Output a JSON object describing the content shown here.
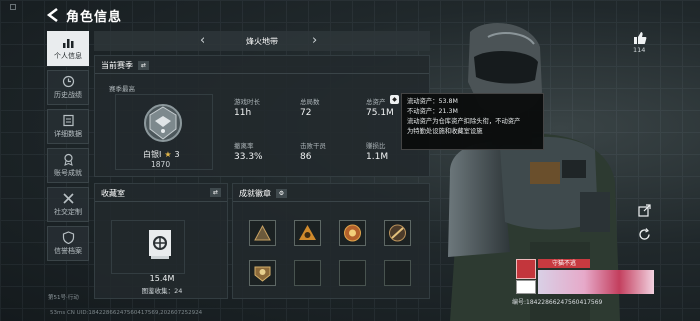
{
  "header": {
    "title": "角色信息"
  },
  "sidebar": {
    "items": [
      {
        "label": "个人信息",
        "icon": "bar-chart-icon",
        "active": true
      },
      {
        "label": "历史战绩",
        "icon": "history-icon"
      },
      {
        "label": "详细数据",
        "icon": "document-icon"
      },
      {
        "label": "账号成就",
        "icon": "achievement-icon"
      },
      {
        "label": "社交定制",
        "icon": "tools-icon"
      },
      {
        "label": "信誉档案",
        "icon": "shield-icon"
      }
    ],
    "footer": "第51号·行动"
  },
  "season": {
    "name": "烽火地带"
  },
  "current_season": {
    "title": "当前赛季",
    "season_high_label": "赛季最高",
    "rank_name": "白银I",
    "rank_stars": "3",
    "rank_score": "1870",
    "stats": [
      {
        "label": "游戏时长",
        "value": "11h"
      },
      {
        "label": "总局数",
        "value": "72"
      },
      {
        "label": "总资产",
        "value": "75.1M"
      },
      {
        "label": "撤离率",
        "value": "33.3%"
      },
      {
        "label": "击败干员",
        "value": "86"
      },
      {
        "label": "赚损比",
        "value": "1.1M"
      }
    ]
  },
  "tooltip": {
    "line1": "流动资产：53.8M",
    "line2": "不动资产：21.3M",
    "line3": "流动资产为仓库资产扣除头衔，不动资产",
    "line4": "为特勤处设施和收藏室设施"
  },
  "collection": {
    "title": "收藏室",
    "value": "15.4M",
    "count_label": "图鉴收集：24"
  },
  "achievements": {
    "title": "成就徽章"
  },
  "right_panel": {
    "like_count": "114"
  },
  "profile": {
    "name": "守猫不逃",
    "uid": "编号:18422866247560417569"
  },
  "bottom": {
    "text": "53ms   CN UID:18422866247560417569,202607252924"
  },
  "colors": {
    "accent": "#d8303a",
    "panel": "#222a2d",
    "active": "#e9ecee"
  }
}
